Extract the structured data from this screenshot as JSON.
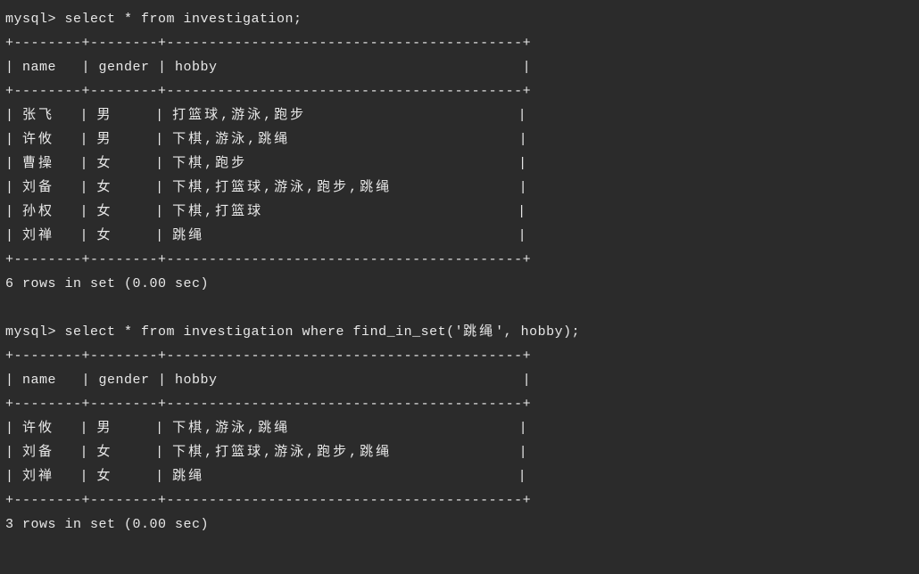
{
  "query1": {
    "prompt": "mysql> ",
    "command": "select * from investigation;",
    "border_top": "+--------+--------+------------------------------------------+",
    "header": "| name   | gender | hobby                                    |",
    "border_mid": "+--------+--------+------------------------------------------+",
    "rows": [
      {
        "name": "张飞",
        "gender": "男",
        "hobby": "打篮球,游泳,跑步"
      },
      {
        "name": "许攸",
        "gender": "男",
        "hobby": "下棋,游泳,跳绳"
      },
      {
        "name": "曹操",
        "gender": "女",
        "hobby": "下棋,跑步"
      },
      {
        "name": "刘备",
        "gender": "女",
        "hobby": "下棋,打篮球,游泳,跑步,跳绳"
      },
      {
        "name": "孙权",
        "gender": "女",
        "hobby": "下棋,打篮球"
      },
      {
        "name": "刘禅",
        "gender": "女",
        "hobby": "跳绳"
      }
    ],
    "border_bot": "+--------+--------+------------------------------------------+",
    "status": "6 rows in set (0.00 sec)"
  },
  "query2": {
    "prompt": "mysql> ",
    "command_pre": "select * from investigation where find_in_set('",
    "command_arg": "跳绳",
    "command_post": "', hobby);",
    "border_top": "+--------+--------+------------------------------------------+",
    "header": "| name   | gender | hobby                                    |",
    "border_mid": "+--------+--------+------------------------------------------+",
    "rows": [
      {
        "name": "许攸",
        "gender": "男",
        "hobby": "下棋,游泳,跳绳"
      },
      {
        "name": "刘备",
        "gender": "女",
        "hobby": "下棋,打篮球,游泳,跑步,跳绳"
      },
      {
        "name": "刘禅",
        "gender": "女",
        "hobby": "跳绳"
      }
    ],
    "border_bot": "+--------+--------+------------------------------------------+",
    "status": "3 rows in set (0.00 sec)"
  }
}
